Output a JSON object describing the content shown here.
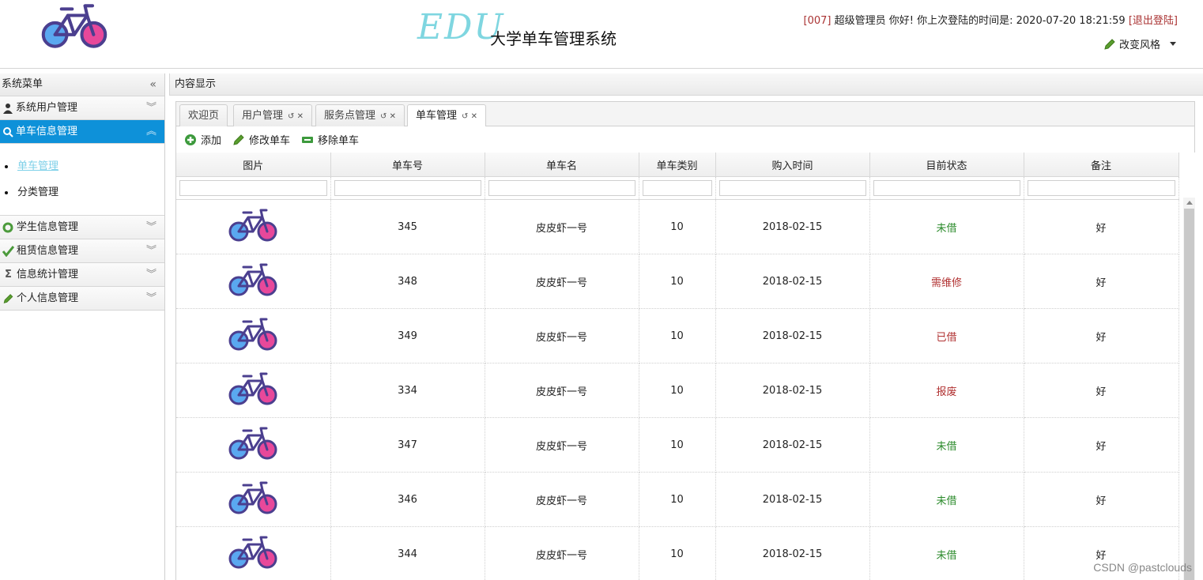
{
  "header": {
    "logo_text": "EDU",
    "system_title": "大学单车管理系统",
    "user_id": "[007]",
    "greeting": "超级管理员 你好! 你上次登陆的时间是:",
    "last_login": "2020-07-20 18:21:59",
    "logout": "[退出登陆]",
    "change_style": "改变风格"
  },
  "sidebar": {
    "title": "系统菜单",
    "menus": [
      {
        "label": "系统用户管理",
        "icon": "user-icon"
      },
      {
        "label": "单车信息管理",
        "icon": "search-icon"
      },
      {
        "label": "学生信息管理",
        "icon": "refresh-icon"
      },
      {
        "label": "租赁信息管理",
        "icon": "check-icon"
      },
      {
        "label": "信息统计管理",
        "icon": "sigma-icon"
      },
      {
        "label": "个人信息管理",
        "icon": "pencil-icon"
      }
    ],
    "submenu": [
      "单车管理",
      "分类管理"
    ]
  },
  "content": {
    "title": "内容显示",
    "tabs": [
      "欢迎页",
      "用户管理",
      "服务点管理",
      "单车管理"
    ],
    "toolbar": {
      "add": "添加",
      "edit": "修改单车",
      "remove": "移除单车"
    },
    "columns": [
      "图片",
      "单车号",
      "单车名",
      "单车类别",
      "购入时间",
      "目前状态",
      "备注"
    ],
    "rows": [
      {
        "no": "345",
        "name": "皮皮虾一号",
        "type": "10",
        "date": "2018-02-15",
        "status": "未借",
        "status_kind": "free",
        "note": "好"
      },
      {
        "no": "348",
        "name": "皮皮虾一号",
        "type": "10",
        "date": "2018-02-15",
        "status": "需维修",
        "status_kind": "bad",
        "note": "好"
      },
      {
        "no": "349",
        "name": "皮皮虾一号",
        "type": "10",
        "date": "2018-02-15",
        "status": "已借",
        "status_kind": "bad",
        "note": "好"
      },
      {
        "no": "334",
        "name": "皮皮虾一号",
        "type": "10",
        "date": "2018-02-15",
        "status": "报废",
        "status_kind": "bad",
        "note": "好"
      },
      {
        "no": "347",
        "name": "皮皮虾一号",
        "type": "10",
        "date": "2018-02-15",
        "status": "未借",
        "status_kind": "free",
        "note": "好"
      },
      {
        "no": "346",
        "name": "皮皮虾一号",
        "type": "10",
        "date": "2018-02-15",
        "status": "未借",
        "status_kind": "free",
        "note": "好"
      },
      {
        "no": "344",
        "name": "皮皮虾一号",
        "type": "10",
        "date": "2018-02-15",
        "status": "未借",
        "status_kind": "free",
        "note": "好"
      }
    ]
  },
  "watermark": "CSDN @pastclouds",
  "colors": {
    "accent": "#0e91d9",
    "free": "#2a8a2a",
    "bad": "#b03030",
    "bike_blue": "#5aa8f0",
    "bike_pink": "#e8489a",
    "bike_frame": "#4b3f8f"
  }
}
